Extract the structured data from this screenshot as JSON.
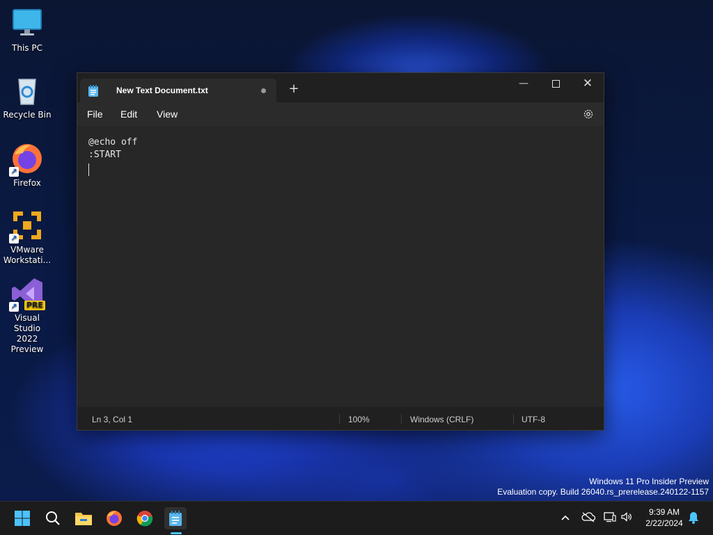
{
  "desktop": {
    "icons": [
      {
        "label": "This PC"
      },
      {
        "label": "Recycle Bin"
      },
      {
        "label": "Firefox"
      },
      {
        "label_line1": "VMware",
        "label_line2": "Workstati..."
      },
      {
        "label_line1": "Visual Studio",
        "label_line2": "2022 Preview",
        "badge": "PRE"
      }
    ]
  },
  "notepad": {
    "tab_title": "New Text Document.txt",
    "menu": {
      "file": "File",
      "edit": "Edit",
      "view": "View"
    },
    "lines": [
      "@echo off",
      ":START"
    ],
    "status": {
      "position": "Ln 3, Col 1",
      "zoom": "100%",
      "line_ending": "Windows (CRLF)",
      "encoding": "UTF-8"
    }
  },
  "watermark": {
    "line1": "Windows 11 Pro Insider Preview",
    "line2": "Evaluation copy. Build 26040.rs_prerelease.240122-1157"
  },
  "taskbar": {
    "time": "9:39 AM",
    "date": "2/22/2024",
    "accent": "#4cc2ff"
  }
}
